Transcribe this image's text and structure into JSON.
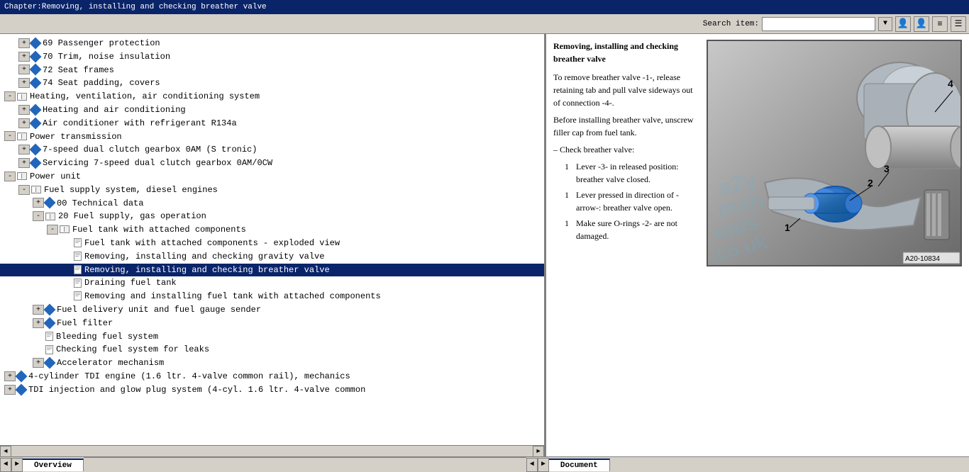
{
  "titleBar": {
    "text": "Chapter:Removing, installing and checking breather valve"
  },
  "toolbar": {
    "searchLabel": "Search item:",
    "searchPlaceholder": "",
    "dropdownArrow": "▼",
    "btn1": "👤",
    "btn2": "👤",
    "btn3": "≡",
    "btn4": "☰"
  },
  "tree": {
    "items": [
      {
        "indent": 1,
        "type": "leaf-folder",
        "expand": "+",
        "icon": "diamond",
        "label": "69 Passenger protection"
      },
      {
        "indent": 1,
        "type": "leaf-folder",
        "expand": "+",
        "icon": "diamond",
        "label": "70 Trim, noise insulation"
      },
      {
        "indent": 1,
        "type": "leaf-folder",
        "expand": "+",
        "icon": "diamond",
        "label": "72 Seat frames"
      },
      {
        "indent": 1,
        "type": "leaf-folder",
        "expand": "+",
        "icon": "diamond",
        "label": "74 Seat padding, covers"
      },
      {
        "indent": 0,
        "type": "folder-open",
        "expand": "-",
        "icon": "book-open",
        "label": "Heating, ventilation, air conditioning system"
      },
      {
        "indent": 1,
        "type": "leaf-folder",
        "expand": "+",
        "icon": "diamond",
        "label": "Heating and air conditioning"
      },
      {
        "indent": 1,
        "type": "leaf-folder",
        "expand": "+",
        "icon": "diamond",
        "label": "Air conditioner with refrigerant R134a"
      },
      {
        "indent": 0,
        "type": "folder-open",
        "expand": "-",
        "icon": "book-open",
        "label": "Power transmission"
      },
      {
        "indent": 1,
        "type": "leaf-folder",
        "expand": "+",
        "icon": "diamond",
        "label": "7-speed dual clutch gearbox 0AM (S tronic)"
      },
      {
        "indent": 1,
        "type": "leaf-folder",
        "expand": "+",
        "icon": "diamond",
        "label": "Servicing 7-speed dual clutch gearbox 0AM/0CW"
      },
      {
        "indent": 0,
        "type": "folder-open",
        "expand": "-",
        "icon": "book-open",
        "label": "Power unit"
      },
      {
        "indent": 1,
        "type": "folder-open",
        "expand": "-",
        "icon": "book-open",
        "label": "Fuel supply system, diesel engines"
      },
      {
        "indent": 2,
        "type": "leaf-folder",
        "expand": "+",
        "icon": "diamond",
        "label": "00 Technical data"
      },
      {
        "indent": 2,
        "type": "folder-open",
        "expand": "-",
        "icon": "book-open",
        "label": "20 Fuel supply, gas operation"
      },
      {
        "indent": 3,
        "type": "folder-open",
        "expand": "-",
        "icon": "book-open",
        "label": "Fuel tank with attached components"
      },
      {
        "indent": 4,
        "type": "doc",
        "icon": "doc",
        "label": "Fuel tank with attached components - exploded view"
      },
      {
        "indent": 4,
        "type": "doc",
        "icon": "doc",
        "label": "Removing, installing and checking gravity valve"
      },
      {
        "indent": 4,
        "type": "doc",
        "icon": "doc",
        "label": "Removing, installing and checking breather valve",
        "selected": true
      },
      {
        "indent": 4,
        "type": "doc",
        "icon": "doc",
        "label": "Draining fuel tank"
      },
      {
        "indent": 4,
        "type": "doc",
        "icon": "doc",
        "label": "Removing and installing fuel tank with attached components"
      },
      {
        "indent": 2,
        "type": "leaf-folder",
        "expand": "+",
        "icon": "diamond",
        "label": "Fuel delivery unit and fuel gauge sender"
      },
      {
        "indent": 2,
        "type": "leaf-folder",
        "expand": "+",
        "icon": "diamond",
        "label": "Fuel filter"
      },
      {
        "indent": 2,
        "type": "doc",
        "icon": "doc",
        "label": "Bleeding fuel system"
      },
      {
        "indent": 2,
        "type": "doc",
        "icon": "doc",
        "label": "Checking fuel system for leaks"
      },
      {
        "indent": 2,
        "type": "leaf-folder",
        "expand": "+",
        "icon": "diamond",
        "label": "Accelerator mechanism"
      },
      {
        "indent": 0,
        "type": "leaf-folder",
        "expand": "+",
        "icon": "diamond",
        "label": "4-cylinder TDI engine (1.6 ltr. 4-valve common rail), mechanics"
      },
      {
        "indent": 0,
        "type": "leaf-folder",
        "expand": "+",
        "icon": "diamond",
        "label": "TDI injection and glow plug system (4-cyl. 1.6 ltr. 4-valve common"
      }
    ]
  },
  "document": {
    "title": "Removing, installing and checking breather valve",
    "paragraphs": [
      {
        "text": "To remove breather valve -1-, release retaining tab and pull valve sideways out of connection -4-."
      },
      {
        "text": "Before installing breather valve, unscrew filler cap from fuel tank."
      },
      {
        "bullet": "–",
        "text": "Check breather valve:"
      },
      {
        "num": "1",
        "text": "Lever -3- in released position: breather valve closed."
      },
      {
        "num": "1",
        "text": "Lever pressed in direction of -arrow-: breather valve open."
      },
      {
        "num": "1",
        "text": "Make sure O-rings -2- are not damaged."
      }
    ],
    "imageLabel": "A20-10834",
    "watermark": "a2ym\nuals\n.co.uk"
  },
  "statusBar": {
    "leftTabs": [
      {
        "label": "Overview",
        "active": true
      }
    ],
    "rightTabs": [
      {
        "label": "Document",
        "active": true
      }
    ],
    "leftNavPrev": "◄",
    "leftNavNext": "►",
    "rightNavPrev": "◄",
    "rightNavNext": "►"
  }
}
